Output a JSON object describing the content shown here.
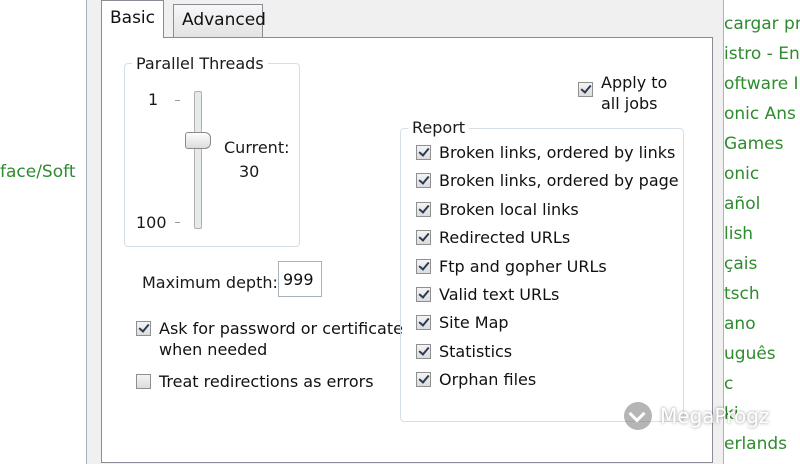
{
  "background": {
    "left_text": "face/Soft",
    "right_items": [
      "cargar pr",
      "istro - En",
      "oftware I",
      "onic Ans",
      "Games",
      "onic",
      "añol",
      "lish",
      "çais",
      "tsch",
      "ano",
      "uguês",
      "c",
      "ki",
      "erlands"
    ]
  },
  "tabs": [
    {
      "label": "Basic",
      "active": true
    },
    {
      "label": "Advanced",
      "active": false
    }
  ],
  "threads": {
    "legend": "Parallel Threads",
    "min_label": "1",
    "max_label": "100",
    "current_label": "Current:",
    "current_value": "30",
    "value": 30,
    "min": 1,
    "max": 100
  },
  "depth": {
    "label": "Maximum depth:",
    "value": "999"
  },
  "options": [
    {
      "label_line1": "Ask for password or certificate",
      "label_line2": "when needed",
      "checked": true
    },
    {
      "label_line1": "Treat redirections as errors",
      "label_line2": "",
      "checked": false
    }
  ],
  "apply": {
    "line1": "Apply to",
    "line2": "all jobs",
    "checked": true
  },
  "report": {
    "legend": "Report",
    "items": [
      {
        "label": "Broken links, ordered by links",
        "checked": true
      },
      {
        "label": "Broken links, ordered by page",
        "checked": true
      },
      {
        "label": "Broken local links",
        "checked": true
      },
      {
        "label": "Redirected URLs",
        "checked": true
      },
      {
        "label": "Ftp and gopher URLs",
        "checked": true
      },
      {
        "label": "Valid text URLs",
        "checked": true
      },
      {
        "label": "Site Map",
        "checked": true
      },
      {
        "label": "Statistics",
        "checked": true
      },
      {
        "label": "Orphan files",
        "checked": true
      }
    ]
  },
  "watermark": {
    "text": "MegaProgz"
  },
  "colors": {
    "link_green": "#2e8b2e",
    "panel_border": "#898c95",
    "dialog_bg": "#f0f0f0"
  }
}
